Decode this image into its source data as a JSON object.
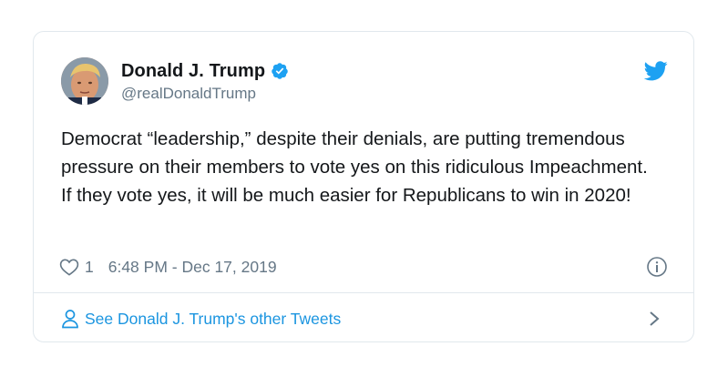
{
  "tweet": {
    "display_name": "Donald J. Trump",
    "handle": "@realDonaldTrump",
    "text": "Democrat “leadership,” despite their denials, are putting tremendous pressure on their members to vote yes on this ridiculous Impeachment. If they vote yes, it will be much easier for Republicans to win in 2020!",
    "like_count": "1",
    "timestamp": "6:48 PM - Dec 17, 2019"
  },
  "footer": {
    "link_label": "See Donald J. Trump's other Tweets"
  },
  "icons": {
    "verified": "verified-badge-icon",
    "bird": "twitter-bird-icon",
    "like": "heart-icon",
    "info": "info-icon",
    "profile": "person-icon",
    "chevron": "chevron-right-icon"
  },
  "colors": {
    "twitter_blue": "#1da1f2",
    "link_blue": "#1b95e0",
    "secondary_text": "#657786",
    "border": "#e1e8ed"
  }
}
